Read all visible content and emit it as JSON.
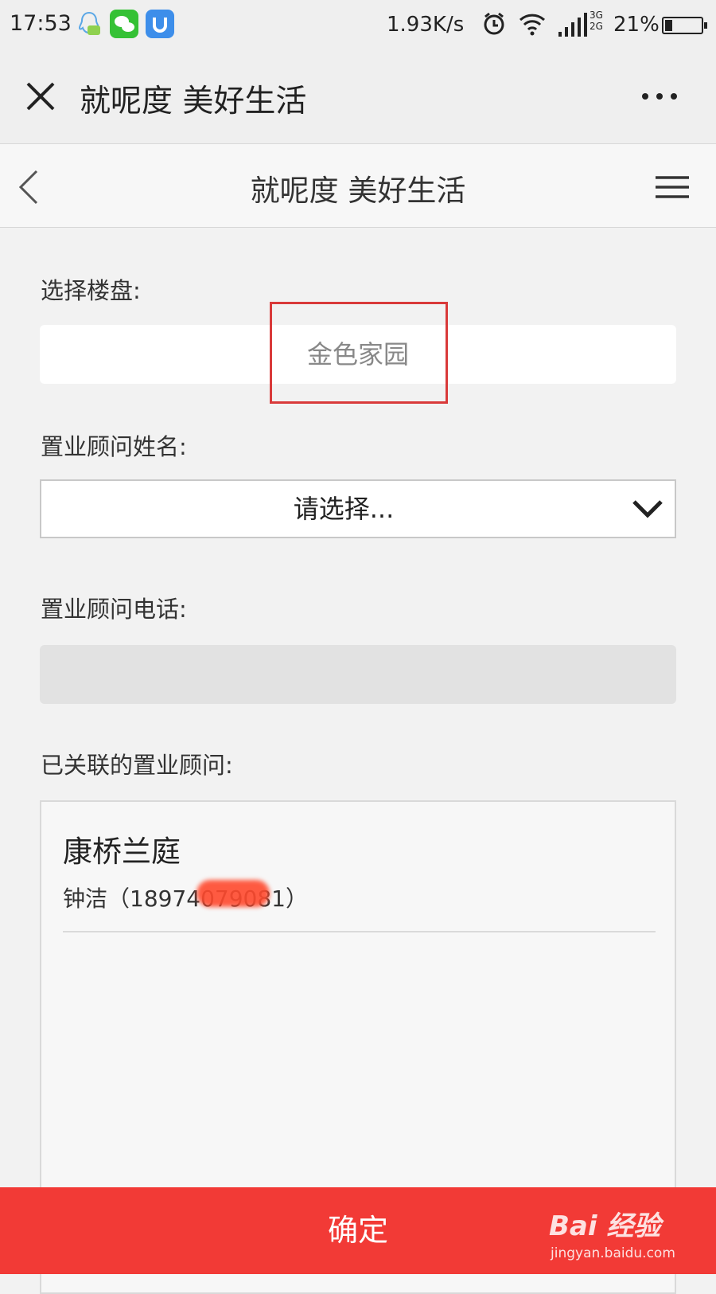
{
  "status_bar": {
    "time": "17:53",
    "speed": "1.93K/s",
    "network": [
      "3G",
      "2G"
    ],
    "battery": "21%",
    "battery_level": 0.21,
    "apps": [
      "qq-icon",
      "wechat-icon",
      "app-store-icon"
    ]
  },
  "title_bar": {
    "title": "就呢度 美好生活"
  },
  "page_nav": {
    "title": "就呢度 美好生活"
  },
  "form": {
    "property_label": "选择楼盘:",
    "property_value": "金色家园",
    "consultant_name_label": "置业顾问姓名:",
    "consultant_select_placeholder": "请选择...",
    "consultant_phone_label": "置业顾问电话:",
    "consultant_phone_value": "",
    "linked_label": "已关联的置业顾问:"
  },
  "linked_consultants": [
    {
      "property": "康桥兰庭",
      "contact": "钟洁（18974079081）"
    }
  ],
  "confirm_button": {
    "label": "确定"
  },
  "watermark": {
    "brand": "Bai 经验",
    "url": "jingyan.baidu.com"
  },
  "colors": {
    "accent_red": "#f23a36",
    "highlight_red": "#d93a3a"
  }
}
